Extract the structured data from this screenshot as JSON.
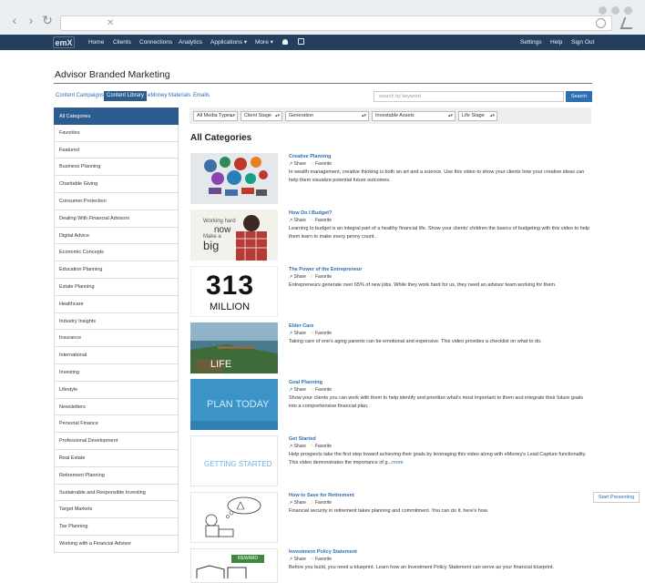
{
  "colors": {
    "navbar": "#243f5d",
    "accent": "#2c6fb2",
    "active_tab": "#2c5d8e"
  },
  "browser": {
    "close_glyph": "✕"
  },
  "appbar": {
    "logo": "emX",
    "items": [
      {
        "label": "Home",
        "icon": ""
      },
      {
        "label": "Clients",
        "icon": ""
      },
      {
        "label": "Connections",
        "icon": ""
      },
      {
        "label": "Analytics",
        "icon": ""
      },
      {
        "label": "Applications ▾",
        "icon": ""
      },
      {
        "label": "More ▾",
        "icon": ""
      }
    ],
    "icons": [
      "bell-icon",
      "checkbox-icon"
    ],
    "right": [
      "Settings",
      "Help",
      "Sign Out"
    ]
  },
  "page": {
    "title": "Advisor Branded Marketing"
  },
  "tabs": [
    "Content Campaigns",
    "Content Library",
    "eMoney Materials",
    "Emails"
  ],
  "search": {
    "placeholder": "search by keyword",
    "button": "Search"
  },
  "sidebar": {
    "items": [
      "All Categories",
      "Favorites",
      "Featured",
      "Business Planning",
      "Charitable Giving",
      "Consumer Protection",
      "Dealing With Financial Advisors",
      "Digital Advice",
      "Economic Concepts",
      "Education Planning",
      "Estate Planning",
      "Healthcare",
      "Industry Insights",
      "Insurance",
      "International",
      "Investing",
      "Lifestyle",
      "Newsletters",
      "Personal Finance",
      "Professional Development",
      "Real Estate",
      "Retirement Planning",
      "Sustainable and Responsible Investing",
      "Target Markets",
      "Tax Planning",
      "Working with a Financial Advisor"
    ]
  },
  "filters": [
    "All Media Types",
    "Client Stage",
    "Generation",
    "Investable Assets",
    "Life Stage"
  ],
  "section": {
    "title": "All Categories"
  },
  "actions": {
    "share": "Share",
    "favorite": "Favorite",
    "share_icon": "share-icon",
    "favorite_icon": "star-icon"
  },
  "cards": [
    {
      "title": "Creative Planning",
      "desc": "In wealth management, creative thinking is both an art and a science. Use this video to show your clients how your creative ideas can help them visualize potential future outcomes.",
      "more": ""
    },
    {
      "title": "How Do I Budget?",
      "desc": "Learning to budget is an integral part of a healthy financial life. Show your clients' children the basics of budgeting with this video to help them learn to make every penny count.",
      "more": "",
      "thumb_text": [
        "Working hard",
        "now",
        "Make a",
        "big"
      ]
    },
    {
      "title": "The Power of the Entrepreneur",
      "desc": "Entrepreneurs generate over 65% of new jobs. While they work hard for us, they need an advisor team working for them.",
      "more": "",
      "thumb_text": [
        "313",
        "MILLION"
      ]
    },
    {
      "title": "Elder Care",
      "desc": "Taking care of one's aging parents can be emotional and expensive. This video provides a checklist on what to do.",
      "more": "",
      "thumb_text": [
        "LIFE"
      ]
    },
    {
      "title": "Goal Planning",
      "desc": "Show your clients you can work with them to help identify and prioritize what's most important to them and integrate their future goals into a comprehensive financial plan.",
      "more": "",
      "thumb_text": [
        "PLAN TODAY"
      ]
    },
    {
      "title": "Get Started",
      "desc": "Help prospects take the first step toward achieving their goals by leveraging this video along with eMoney's Lead Capture functionality. This video demonstrates the importance of g...",
      "more": "more",
      "thumb_text": [
        "GETTING STARTED"
      ]
    },
    {
      "title": "How to Save for Retirement",
      "desc": "Financial security in retirement takes planning and commitment. You can do it, here's how.",
      "more": ""
    },
    {
      "title": "Investment Policy Statement",
      "desc": "Before you build, you need a blueprint. Learn how an Investment Policy Statement can serve as your financial blueprint.",
      "more": "",
      "thumb_text": [
        "REWARD"
      ]
    }
  ],
  "start_presenting": "Start Presenting"
}
